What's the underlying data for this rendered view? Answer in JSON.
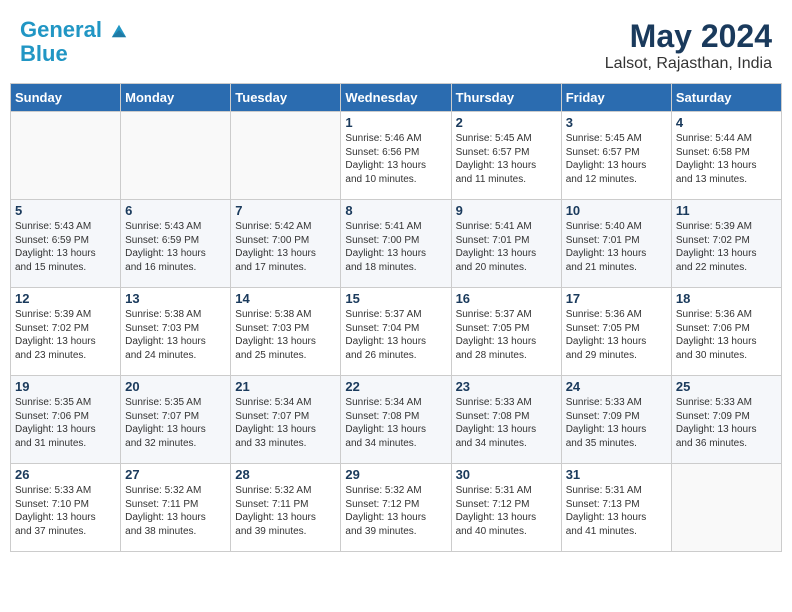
{
  "header": {
    "logo_line1": "General",
    "logo_line2": "Blue",
    "month": "May 2024",
    "location": "Lalsot, Rajasthan, India"
  },
  "days_of_week": [
    "Sunday",
    "Monday",
    "Tuesday",
    "Wednesday",
    "Thursday",
    "Friday",
    "Saturday"
  ],
  "weeks": [
    [
      {
        "day": "",
        "content": ""
      },
      {
        "day": "",
        "content": ""
      },
      {
        "day": "",
        "content": ""
      },
      {
        "day": "1",
        "content": "Sunrise: 5:46 AM\nSunset: 6:56 PM\nDaylight: 13 hours\nand 10 minutes."
      },
      {
        "day": "2",
        "content": "Sunrise: 5:45 AM\nSunset: 6:57 PM\nDaylight: 13 hours\nand 11 minutes."
      },
      {
        "day": "3",
        "content": "Sunrise: 5:45 AM\nSunset: 6:57 PM\nDaylight: 13 hours\nand 12 minutes."
      },
      {
        "day": "4",
        "content": "Sunrise: 5:44 AM\nSunset: 6:58 PM\nDaylight: 13 hours\nand 13 minutes."
      }
    ],
    [
      {
        "day": "5",
        "content": "Sunrise: 5:43 AM\nSunset: 6:59 PM\nDaylight: 13 hours\nand 15 minutes."
      },
      {
        "day": "6",
        "content": "Sunrise: 5:43 AM\nSunset: 6:59 PM\nDaylight: 13 hours\nand 16 minutes."
      },
      {
        "day": "7",
        "content": "Sunrise: 5:42 AM\nSunset: 7:00 PM\nDaylight: 13 hours\nand 17 minutes."
      },
      {
        "day": "8",
        "content": "Sunrise: 5:41 AM\nSunset: 7:00 PM\nDaylight: 13 hours\nand 18 minutes."
      },
      {
        "day": "9",
        "content": "Sunrise: 5:41 AM\nSunset: 7:01 PM\nDaylight: 13 hours\nand 20 minutes."
      },
      {
        "day": "10",
        "content": "Sunrise: 5:40 AM\nSunset: 7:01 PM\nDaylight: 13 hours\nand 21 minutes."
      },
      {
        "day": "11",
        "content": "Sunrise: 5:39 AM\nSunset: 7:02 PM\nDaylight: 13 hours\nand 22 minutes."
      }
    ],
    [
      {
        "day": "12",
        "content": "Sunrise: 5:39 AM\nSunset: 7:02 PM\nDaylight: 13 hours\nand 23 minutes."
      },
      {
        "day": "13",
        "content": "Sunrise: 5:38 AM\nSunset: 7:03 PM\nDaylight: 13 hours\nand 24 minutes."
      },
      {
        "day": "14",
        "content": "Sunrise: 5:38 AM\nSunset: 7:03 PM\nDaylight: 13 hours\nand 25 minutes."
      },
      {
        "day": "15",
        "content": "Sunrise: 5:37 AM\nSunset: 7:04 PM\nDaylight: 13 hours\nand 26 minutes."
      },
      {
        "day": "16",
        "content": "Sunrise: 5:37 AM\nSunset: 7:05 PM\nDaylight: 13 hours\nand 28 minutes."
      },
      {
        "day": "17",
        "content": "Sunrise: 5:36 AM\nSunset: 7:05 PM\nDaylight: 13 hours\nand 29 minutes."
      },
      {
        "day": "18",
        "content": "Sunrise: 5:36 AM\nSunset: 7:06 PM\nDaylight: 13 hours\nand 30 minutes."
      }
    ],
    [
      {
        "day": "19",
        "content": "Sunrise: 5:35 AM\nSunset: 7:06 PM\nDaylight: 13 hours\nand 31 minutes."
      },
      {
        "day": "20",
        "content": "Sunrise: 5:35 AM\nSunset: 7:07 PM\nDaylight: 13 hours\nand 32 minutes."
      },
      {
        "day": "21",
        "content": "Sunrise: 5:34 AM\nSunset: 7:07 PM\nDaylight: 13 hours\nand 33 minutes."
      },
      {
        "day": "22",
        "content": "Sunrise: 5:34 AM\nSunset: 7:08 PM\nDaylight: 13 hours\nand 34 minutes."
      },
      {
        "day": "23",
        "content": "Sunrise: 5:33 AM\nSunset: 7:08 PM\nDaylight: 13 hours\nand 34 minutes."
      },
      {
        "day": "24",
        "content": "Sunrise: 5:33 AM\nSunset: 7:09 PM\nDaylight: 13 hours\nand 35 minutes."
      },
      {
        "day": "25",
        "content": "Sunrise: 5:33 AM\nSunset: 7:09 PM\nDaylight: 13 hours\nand 36 minutes."
      }
    ],
    [
      {
        "day": "26",
        "content": "Sunrise: 5:33 AM\nSunset: 7:10 PM\nDaylight: 13 hours\nand 37 minutes."
      },
      {
        "day": "27",
        "content": "Sunrise: 5:32 AM\nSunset: 7:11 PM\nDaylight: 13 hours\nand 38 minutes."
      },
      {
        "day": "28",
        "content": "Sunrise: 5:32 AM\nSunset: 7:11 PM\nDaylight: 13 hours\nand 39 minutes."
      },
      {
        "day": "29",
        "content": "Sunrise: 5:32 AM\nSunset: 7:12 PM\nDaylight: 13 hours\nand 39 minutes."
      },
      {
        "day": "30",
        "content": "Sunrise: 5:31 AM\nSunset: 7:12 PM\nDaylight: 13 hours\nand 40 minutes."
      },
      {
        "day": "31",
        "content": "Sunrise: 5:31 AM\nSunset: 7:13 PM\nDaylight: 13 hours\nand 41 minutes."
      },
      {
        "day": "",
        "content": ""
      }
    ]
  ]
}
